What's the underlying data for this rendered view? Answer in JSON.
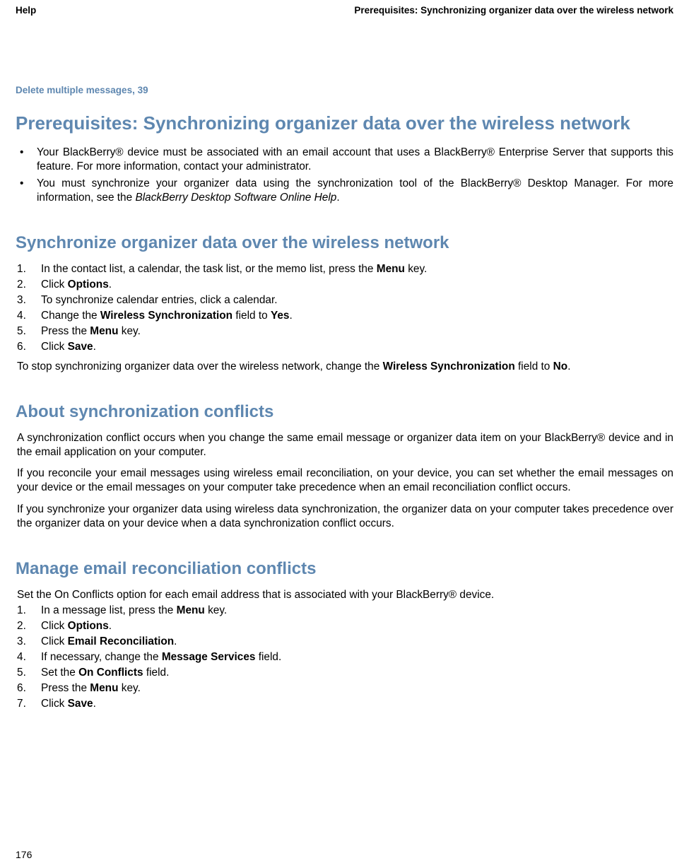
{
  "header": {
    "left": "Help",
    "right": "Prerequisites: Synchronizing organizer data over the wireless network"
  },
  "link": "Delete multiple messages, 39",
  "h1": "Prerequisites: Synchronizing organizer data over the wireless network",
  "bullets": [
    "Your BlackBerry® device must be associated with an email account that uses a BlackBerry® Enterprise Server that supports this feature. For more information, contact your administrator.",
    "You must synchronize your organizer data using the synchronization tool of the BlackBerry® Desktop Manager. For more information, see the  <i>BlackBerry Desktop Software Online Help</i>."
  ],
  "section2": {
    "title": "Synchronize organizer data over the wireless network",
    "steps": [
      "In the contact list, a calendar, the task list, or the memo list, press the <b>Menu</b> key.",
      "Click <b>Options</b>.",
      "To synchronize calendar entries, click a calendar.",
      "Change the <b>Wireless Synchronization</b> field to <b>Yes</b>.",
      "Press the <b>Menu</b> key.",
      "Click <b>Save</b>."
    ],
    "note": "To stop synchronizing organizer data over the wireless network, change the <b>Wireless Synchronization</b> field to <b>No</b>."
  },
  "section3": {
    "title": "About synchronization conflicts",
    "paras": [
      "A synchronization conflict occurs when you change the same email message or organizer data item on your BlackBerry® device and in the email application on your computer.",
      "If you reconcile your email messages using wireless email reconciliation, on your device, you can set whether the email messages on your device or the email messages on your computer take precedence when an email reconciliation conflict occurs.",
      "If you synchronize your organizer data using wireless data synchronization, the organizer data on your computer takes precedence over the organizer data on your device when a data synchronization conflict occurs."
    ]
  },
  "section4": {
    "title": "Manage email reconciliation conflicts",
    "intro": "Set the On Conflicts option for each email address that is associated with your BlackBerry® device.",
    "steps": [
      "In a message list, press the <b>Menu</b> key.",
      "Click <b>Options</b>.",
      "Click <b>Email Reconciliation</b>.",
      "If necessary, change the <b>Message Services</b> field.",
      "Set the <b>On Conflicts</b> field.",
      "Press the <b>Menu</b> key.",
      "Click <b>Save</b>."
    ]
  },
  "pageNumber": "176"
}
